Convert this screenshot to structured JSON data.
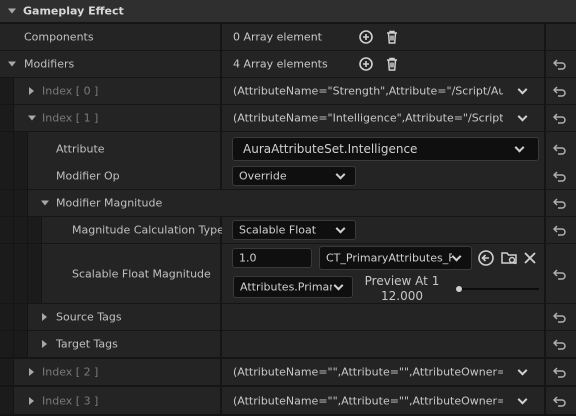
{
  "section": {
    "title": "Gameplay Effect"
  },
  "components": {
    "label": "Components",
    "value": "0 Array element"
  },
  "modifiers": {
    "label": "Modifiers",
    "value": "4 Array elements"
  },
  "index0": {
    "label": "Index [ 0 ]",
    "value": "(AttributeName=\"Strength\",Attribute=\"/Script/Aura.Au"
  },
  "index1": {
    "label": "Index [ 1 ]",
    "value": "(AttributeName=\"Intelligence\",Attribute=\"/Script/Aura"
  },
  "attribute": {
    "label": "Attribute",
    "value": "AuraAttributeSet.Intelligence"
  },
  "modifier_op": {
    "label": "Modifier Op",
    "value": "Override"
  },
  "modifier_magnitude": {
    "label": "Modifier Magnitude"
  },
  "calc_type": {
    "label": "Magnitude Calculation Type",
    "value": "Scalable Float"
  },
  "scalable_float": {
    "label": "Scalable Float Magnitude",
    "value": "1.0",
    "curve_table": "CT_PrimaryAttributes_F",
    "row_name": "Attributes.Primar",
    "preview_label": "Preview At 1",
    "preview_value": "12.000",
    "preview_slider": 0
  },
  "source_tags": {
    "label": "Source Tags"
  },
  "target_tags": {
    "label": "Target Tags"
  },
  "index2": {
    "label": "Index [ 2 ]",
    "value": "(AttributeName=\"\",Attribute=\"\",AttributeOwner=None)"
  },
  "index3": {
    "label": "Index [ 3 ]",
    "value": "(AttributeName=\"\",Attribute=\"\",AttributeOwner=None)"
  },
  "icons": {
    "add": "add-icon",
    "delete": "trash-icon",
    "reset": "reset-to-default-icon",
    "browse": "browse-icon",
    "clear": "close-icon",
    "use": "use-selected-icon"
  },
  "colors": {
    "background": "#151515",
    "row": "#242424",
    "header": "#2f2f2f",
    "field": "#0f0f0f",
    "text": "#c0c0c0"
  }
}
